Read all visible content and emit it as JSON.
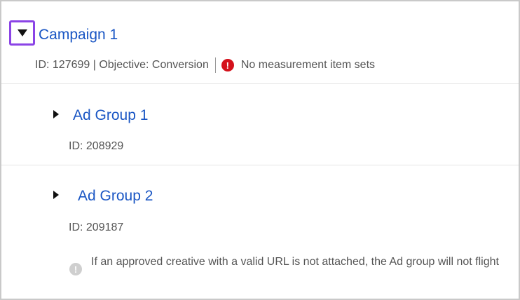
{
  "campaign": {
    "title": "Campaign 1",
    "meta": "ID: 127699 | Objective: Conversion",
    "error_text": "No measurement item sets",
    "error_glyph": "!"
  },
  "ad_groups": [
    {
      "title": "Ad Group 1",
      "id_text": "ID: 208929"
    },
    {
      "title": "Ad Group 2",
      "id_text": "ID: 209187",
      "warning_glyph": "!",
      "warning_text": "If an approved creative with a valid URL is not attached, the Ad group will not flight"
    }
  ],
  "colors": {
    "link": "#1a56c4",
    "highlight": "#8b44e6",
    "error": "#d4111b",
    "info": "#cfcfcf"
  }
}
